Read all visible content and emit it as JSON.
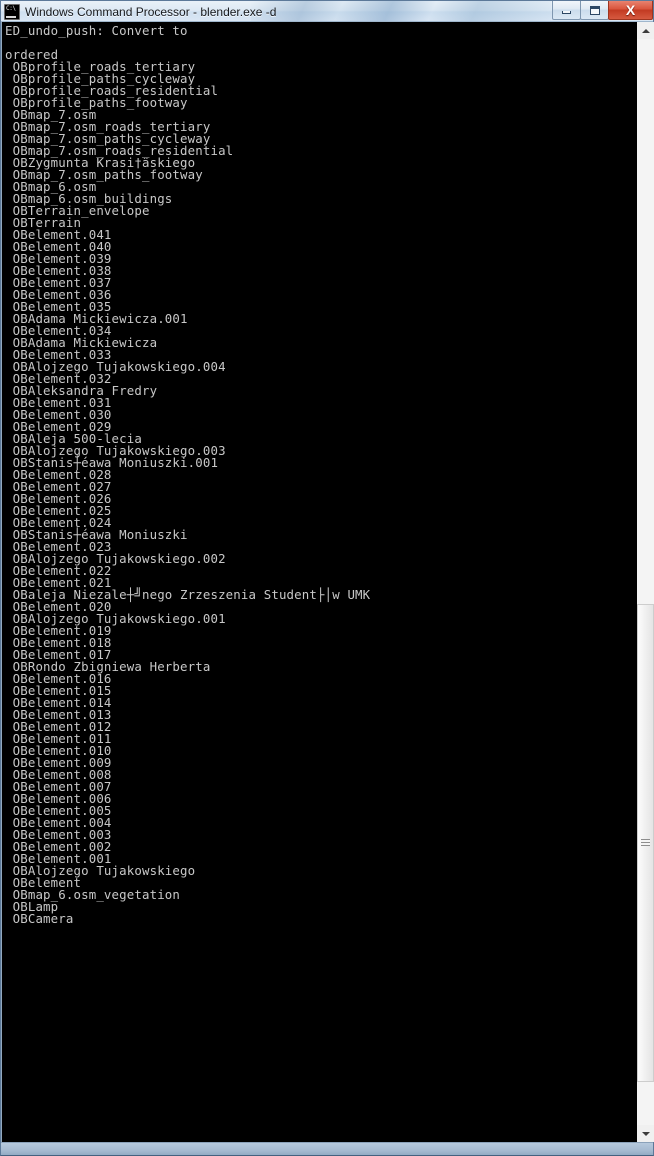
{
  "window": {
    "title": "Windows Command Processor - blender.exe  -d",
    "icon": "cmd-console-icon",
    "minimize_label": "Minimize",
    "maximize_label": "Restore",
    "close_label": "X"
  },
  "scrollbar": {
    "up_arrow": "scroll-up-arrow",
    "down_arrow": "scroll-down-arrow",
    "thumb_top_pct": 52,
    "thumb_height_pct": 44
  },
  "console": {
    "background": "#000000",
    "foreground": "#c8c8c8",
    "lines": [
      "ED_undo_push: Convert to",
      "",
      "ordered",
      " OBprofile_roads_tertiary",
      " OBprofile_paths_cycleway",
      " OBprofile_roads_residential",
      " OBprofile_paths_footway",
      " OBmap_7.osm",
      " OBmap_7.osm_roads_tertiary",
      " OBmap_7.osm_paths_cycleway",
      " OBmap_7.osm_roads_residential",
      " OBZygmunta Krasi†äskiego",
      " OBmap_7.osm_paths_footway",
      " OBmap_6.osm",
      " OBmap_6.osm_buildings",
      " OBTerrain_envelope",
      " OBTerrain",
      " OBelement.041",
      " OBelement.040",
      " OBelement.039",
      " OBelement.038",
      " OBelement.037",
      " OBelement.036",
      " OBelement.035",
      " OBAdama Mickiewicza.001",
      " OBelement.034",
      " OBAdama Mickiewicza",
      " OBelement.033",
      " OBAlojzego Tujakowskiego.004",
      " OBelement.032",
      " OBAleksandra Fredry",
      " OBelement.031",
      " OBelement.030",
      " OBelement.029",
      " OBAleja 500-lecia",
      " OBAlojzego Tujakowskiego.003",
      " OBStanis┼éawa Moniuszki.001",
      " OBelement.028",
      " OBelement.027",
      " OBelement.026",
      " OBelement.025",
      " OBelement.024",
      " OBStanis┼éawa Moniuszki",
      " OBelement.023",
      " OBAlojzego Tujakowskiego.002",
      " OBelement.022",
      " OBelement.021",
      " OBaleja Niezale┼╝nego Zrzeszenia Student├│w UMK",
      " OBelement.020",
      " OBAlojzego Tujakowskiego.001",
      " OBelement.019",
      " OBelement.018",
      " OBelement.017",
      " OBRondo Zbigniewa Herberta",
      " OBelement.016",
      " OBelement.015",
      " OBelement.014",
      " OBelement.013",
      " OBelement.012",
      " OBelement.011",
      " OBelement.010",
      " OBelement.009",
      " OBelement.008",
      " OBelement.007",
      " OBelement.006",
      " OBelement.005",
      " OBelement.004",
      " OBelement.003",
      " OBelement.002",
      " OBelement.001",
      " OBAlojzego Tujakowskiego",
      " OBelement",
      " OBmap_6.osm_vegetation",
      " OBLamp",
      " OBCamera"
    ]
  }
}
